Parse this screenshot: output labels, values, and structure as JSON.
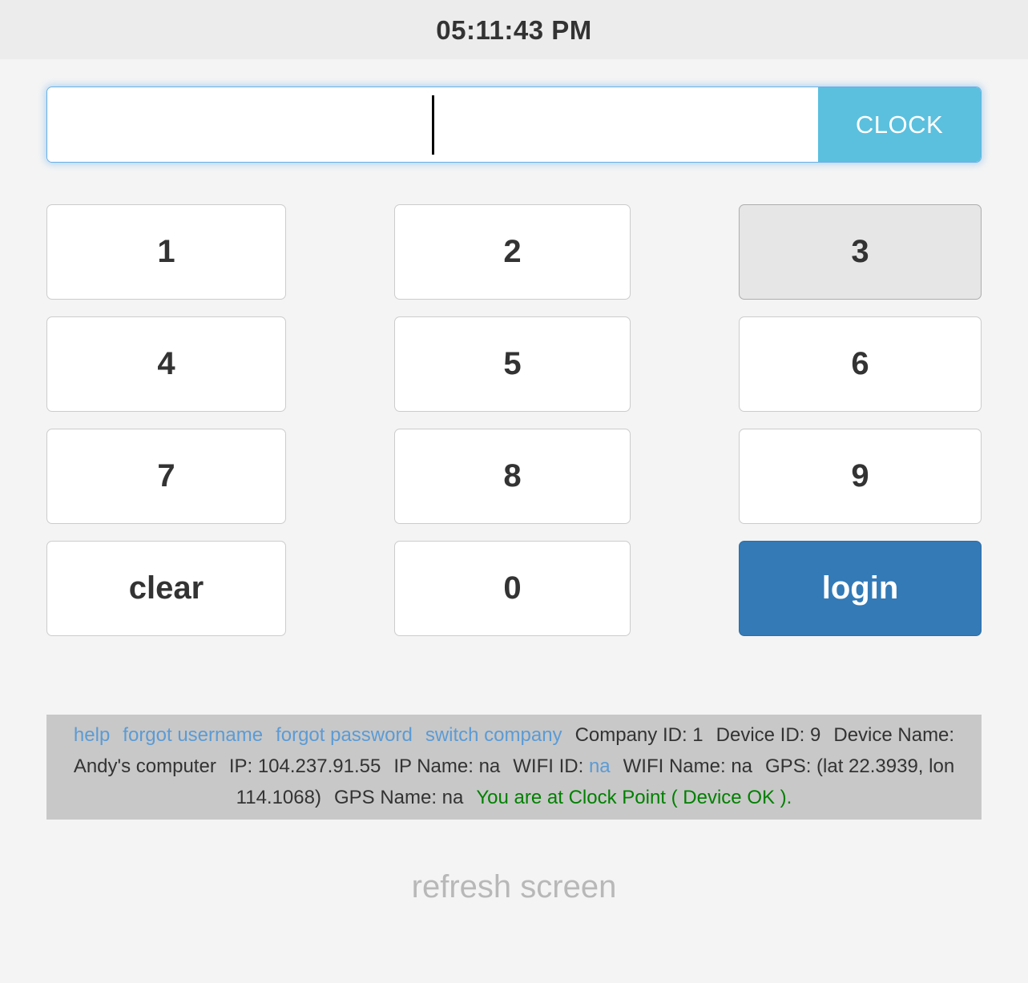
{
  "header": {
    "time": "05:11:43 PM"
  },
  "pin_entry": {
    "value": "",
    "placeholder": "",
    "clock_label": "CLOCK",
    "caret_visible": true,
    "focus_color": "#66afe9",
    "clock_button_color": "#5bc0de"
  },
  "keypad": {
    "keys": [
      {
        "label": "1",
        "name": "key-1",
        "state": "normal"
      },
      {
        "label": "2",
        "name": "key-2",
        "state": "normal"
      },
      {
        "label": "3",
        "name": "key-3",
        "state": "active"
      },
      {
        "label": "4",
        "name": "key-4",
        "state": "normal"
      },
      {
        "label": "5",
        "name": "key-5",
        "state": "normal"
      },
      {
        "label": "6",
        "name": "key-6",
        "state": "normal"
      },
      {
        "label": "7",
        "name": "key-7",
        "state": "normal"
      },
      {
        "label": "8",
        "name": "key-8",
        "state": "normal"
      },
      {
        "label": "9",
        "name": "key-9",
        "state": "normal"
      },
      {
        "label": "clear",
        "name": "key-clear",
        "state": "normal"
      },
      {
        "label": "0",
        "name": "key-0",
        "state": "normal"
      },
      {
        "label": "login",
        "name": "key-login",
        "state": "primary"
      }
    ],
    "active_key_color": "#e6e6e6",
    "login_color": "#337ab7"
  },
  "info": {
    "links": {
      "help": "help",
      "forgot_username": "forgot username",
      "forgot_password": "forgot password",
      "switch_company": "switch company",
      "wifi_id_value": "na"
    },
    "company_id": "Company ID: 1",
    "device_id": "Device ID: 9",
    "device_name": "Device Name: Andy's computer",
    "ip": "IP: 104.237.91.55",
    "ip_name": "IP Name: na",
    "wifi_id_label": "WIFI ID:",
    "wifi_name": "WIFI Name: na",
    "gps": "GPS: (lat 22.3939, lon 114.1068)",
    "gps_name": "GPS Name: na",
    "status": "You are at Clock Point ( Device OK ).",
    "status_color": "#008000",
    "link_color": "#5b9bd5",
    "panel_color": "#c8c8c8"
  },
  "footer": {
    "refresh_label": "refresh screen"
  }
}
